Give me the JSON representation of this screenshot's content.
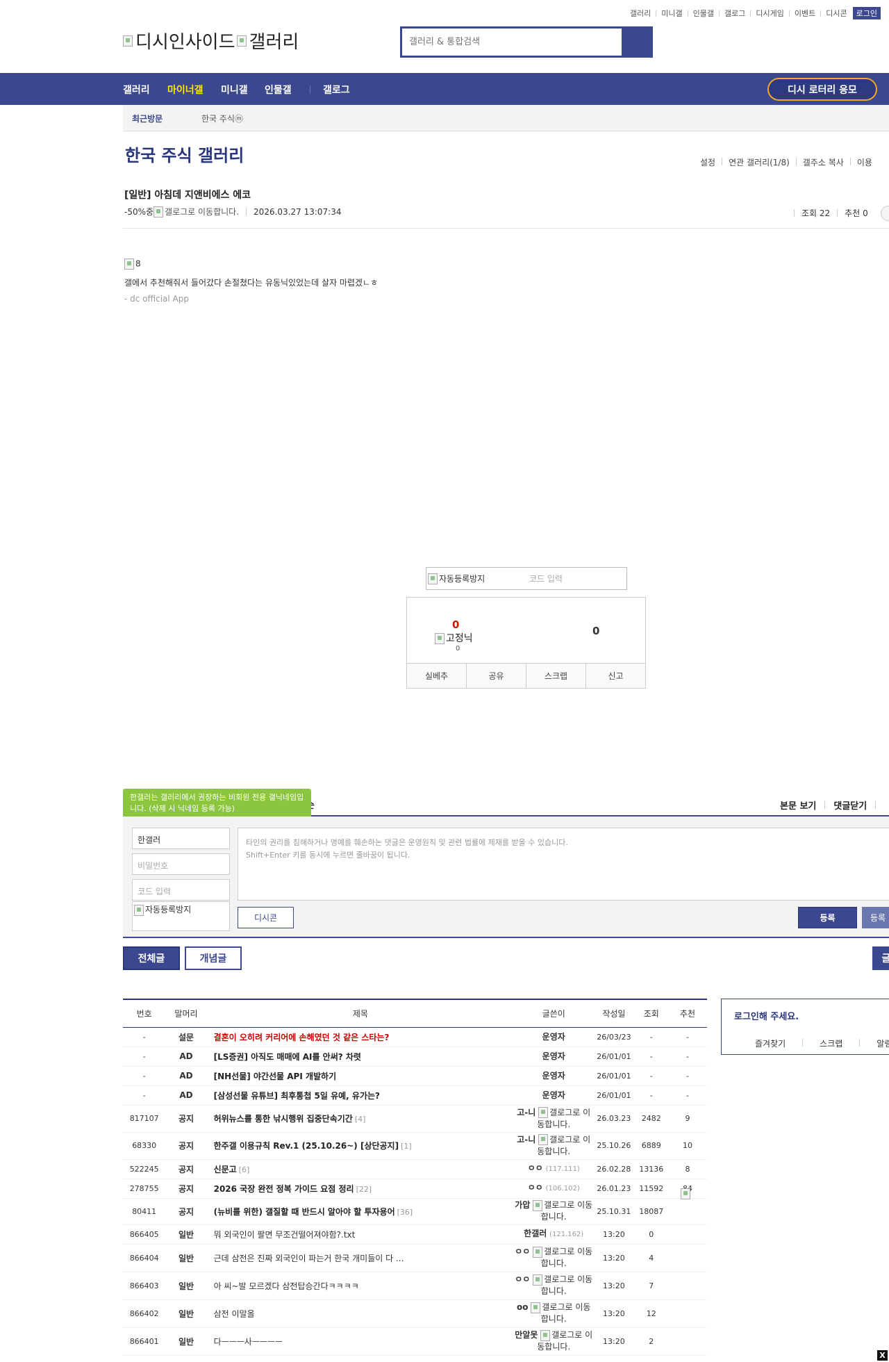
{
  "top_links": [
    "갤러리",
    "미니갤",
    "인물갤",
    "갤로그",
    "디시게임",
    "이벤트",
    "디시콘"
  ],
  "login_button": "로그인",
  "logo": {
    "alt1": "디시인사이드",
    "alt2": "갤러리"
  },
  "search": {
    "placeholder": "갤러리 & 통합검색"
  },
  "nav": {
    "items": [
      "갤러리",
      "마이너갤",
      "미니갤",
      "인물갤",
      "갤로그"
    ],
    "active_index": 1,
    "lotto": "디시 로터리 응모"
  },
  "recent": {
    "label": "최근방문",
    "gallery": "한국 주식ⓜ"
  },
  "gallery": {
    "title": "한국 주식 갤러리",
    "menu": [
      "설정",
      "연관 갤러리(1/8)",
      "갤주소 복사",
      "이용"
    ]
  },
  "post": {
    "title": "[일반] 아침데 지앤비에스 에코",
    "author": "-50%중",
    "author_img_alt": "갤로그로 이동합니다.",
    "date": "2026.03.27 13:07:34",
    "views_label": "조회 22",
    "recommend_label": "추천 0",
    "image_alt": "8",
    "body": "갤에서 추천해줘서 들어갔다 손절쳤다는 유동닉있었는데 살자 마렵겠ㄴㅎ",
    "footer": "- dc official App"
  },
  "captcha": {
    "img_alt": "자동등록방지",
    "placeholder": "코드 입력"
  },
  "vote": {
    "up_count": "0",
    "fixed_nick_alt": "고정닉",
    "fixed_nick_count": "0",
    "down_count": "0",
    "buttons": [
      "실베추",
      "공유",
      "스크랩",
      "신고"
    ]
  },
  "comment": {
    "tooltip": "한갤러는 갤러리에서 권장하는 비회원 전용 갤닉네임입니다. (삭제 시 닉네임 등록 가능)",
    "head_tail": "순",
    "links": [
      "본문 보기",
      "댓글닫기"
    ],
    "name_value": "한갤러",
    "pw_placeholder": "비밀번호",
    "code_placeholder": "코드 입력",
    "captcha_alt": "자동등록방지",
    "textarea_line1": "타인의 권리를 침해하거나 명예를 훼손하는 댓글은 운영원칙 및 관련 법률에 제재를 받을 수 있습니다.",
    "textarea_line2": "Shift+Enter 키를 동시에 누르면 줄바꿈이 됩니다.",
    "dccon": "디시콘",
    "submit": "등록",
    "submit2": "등록"
  },
  "tabs": {
    "all": "전체글",
    "concept": "개념글",
    "right": "글"
  },
  "list": {
    "headers": [
      "번호",
      "말머리",
      "제목",
      "글쓴이",
      "작성일",
      "조회",
      "추천"
    ],
    "rows": [
      {
        "num": "-",
        "head": "설문",
        "title": "결혼이 오히려 커리어에 손해였던 것 같은 스타는?",
        "style": "red",
        "count": "",
        "writer": "운영자",
        "ip": "",
        "gallog": false,
        "date": "26/03/23",
        "views": "-",
        "rec": "-"
      },
      {
        "num": "-",
        "head": "AD",
        "title": "[LS증권] 아직도 매매에 AI를 안써? 차렷",
        "style": "bold",
        "count": "",
        "writer": "운영자",
        "ip": "",
        "gallog": false,
        "date": "26/01/01",
        "views": "-",
        "rec": "-"
      },
      {
        "num": "-",
        "head": "AD",
        "title": "[NH선물] 야간선물 API 개발하기",
        "style": "bold",
        "count": "",
        "writer": "운영자",
        "ip": "",
        "gallog": false,
        "date": "26/01/01",
        "views": "-",
        "rec": "-"
      },
      {
        "num": "-",
        "head": "AD",
        "title": "[삼성선물 유튜브] 최후통첩 5일 유예, 유가는?",
        "style": "bold",
        "count": "",
        "writer": "운영자",
        "ip": "",
        "gallog": false,
        "date": "26/01/01",
        "views": "-",
        "rec": "-"
      },
      {
        "num": "817107",
        "head": "공지",
        "title": "허위뉴스를 통한 낚시행위 집중단속기간",
        "style": "bold",
        "count": "[4]",
        "writer": "고-니",
        "ip": "",
        "gallog": true,
        "date": "26.03.23",
        "views": "2482",
        "rec": "9"
      },
      {
        "num": "68330",
        "head": "공지",
        "title": "한주갤 이용규칙 Rev.1 (25.10.26~) [상단공지]",
        "style": "bold",
        "count": "[1]",
        "writer": "고-니",
        "ip": "",
        "gallog": true,
        "date": "25.10.26",
        "views": "6889",
        "rec": "10"
      },
      {
        "num": "522245",
        "head": "공지",
        "title": "신문고",
        "style": "bold",
        "count": "[6]",
        "writer": "ㅇㅇ",
        "ip": "(117.111)",
        "gallog": false,
        "date": "26.02.28",
        "views": "13136",
        "rec": "8"
      },
      {
        "num": "278755",
        "head": "공지",
        "title": "2026 국장 완전 정복 가이드 요점 정리",
        "style": "bold",
        "count": "[22]",
        "writer": "ㅇㅇ",
        "ip": "(106.102)",
        "gallog": false,
        "date": "26.01.23",
        "views": "11592",
        "rec": "84"
      },
      {
        "num": "80411",
        "head": "공지",
        "title": "(뉴비를 위한) 갤질할 때 반드시 알아야 할 투자용어",
        "style": "bold",
        "count": "[36]",
        "writer": "가압",
        "ip": "",
        "gallog": true,
        "date": "25.10.31",
        "views": "18087",
        "rec": ""
      },
      {
        "num": "866405",
        "head": "일반",
        "title": "뭐 외국인이 팔면 무조건떨어져야함?.txt",
        "style": "",
        "count": "",
        "writer": "한갤러",
        "ip": "(121.162)",
        "gallog": false,
        "date": "13:20",
        "views": "0",
        "rec": ""
      },
      {
        "num": "866404",
        "head": "일반",
        "title": "근데 삼전은 진짜 외국인이 파는거 한국 개미들이 다 ...",
        "style": "",
        "count": "",
        "writer": "ㅇㅇ",
        "ip": "",
        "gallog": true,
        "date": "13:20",
        "views": "4",
        "rec": ""
      },
      {
        "num": "866403",
        "head": "일반",
        "title": "아 씨~발 모르겠다 삼전탑승간다ㅋㅋㅋㅋ",
        "style": "",
        "count": "",
        "writer": "ㅇㅇ",
        "ip": "",
        "gallog": true,
        "date": "13:20",
        "views": "7",
        "rec": ""
      },
      {
        "num": "866402",
        "head": "일반",
        "title": "삼전 이말올",
        "style": "",
        "count": "",
        "writer": "oo",
        "ip": "",
        "gallog": true,
        "date": "13:20",
        "views": "12",
        "rec": ""
      },
      {
        "num": "866401",
        "head": "일반",
        "title": "다ㅡㅡㅡ사ㅡㅡㅡㅡ",
        "style": "",
        "count": "",
        "writer": "만알못",
        "ip": "",
        "gallog": true,
        "date": "13:20",
        "views": "2",
        "rec": ""
      }
    ],
    "gallog_alt": "갤로그로 이동합니다."
  },
  "login_box": {
    "message": "로그인해 주세요.",
    "links": [
      "즐겨찾기",
      "스크랩",
      "알림"
    ]
  },
  "close_label": "X"
}
